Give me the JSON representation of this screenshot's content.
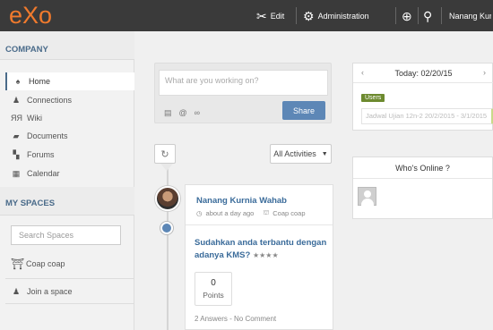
{
  "topbar": {
    "logo": "eXo",
    "edit": "Edit",
    "administration": "Administration",
    "user_name": "Nanang Kurnia Wahab"
  },
  "sidebar": {
    "company_title": "COMPANY",
    "items": [
      {
        "label": "Home",
        "icon": "home-icon"
      },
      {
        "label": "Connections",
        "icon": "person-icon"
      },
      {
        "label": "Wiki",
        "icon": "wiki-icon"
      },
      {
        "label": "Documents",
        "icon": "folder-icon"
      },
      {
        "label": "Forums",
        "icon": "forum-icon"
      },
      {
        "label": "Calendar",
        "icon": "calendar-icon"
      }
    ],
    "spaces_title": "MY SPACES",
    "search_placeholder": "Search Spaces",
    "space_item": "Coap coap",
    "join_space": "Join a space"
  },
  "composer": {
    "placeholder": "What are you working on?",
    "share": "Share"
  },
  "stream": {
    "filter": "All Activities"
  },
  "activity": {
    "author": "Nanang Kurnia Wahab",
    "time": "about a day ago",
    "space": "Coap coap",
    "title": "Sudahkan anda terbantu dengan adanya KMS?",
    "rating_stars": "★★★★",
    "points_value": "0",
    "points_label": "Points",
    "footer": "2 Answers - No Comment"
  },
  "calendar": {
    "today": "Today: 02/20/15",
    "badge": "Users",
    "event": "Jadwal Ujian 12n-2 20/2/2015 - 3/1/2015"
  },
  "online": {
    "title": "Who's Online ?"
  }
}
